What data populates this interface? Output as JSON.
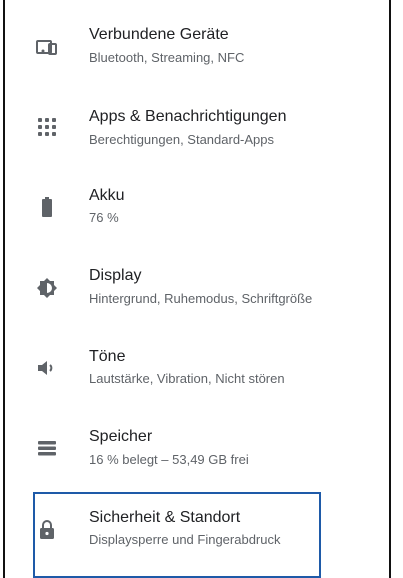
{
  "settings": {
    "items": [
      {
        "icon": "devices-icon",
        "title": "Verbundene Geräte",
        "subtitle": "Bluetooth, Streaming, NFC"
      },
      {
        "icon": "apps-grid-icon",
        "title": "Apps & Benachrichtigungen",
        "subtitle": "Berechtigungen, Standard-Apps"
      },
      {
        "icon": "battery-icon",
        "title": "Akku",
        "subtitle": "76 %"
      },
      {
        "icon": "brightness-icon",
        "title": "Display",
        "subtitle": "Hintergrund, Ruhemodus, Schriftgröße"
      },
      {
        "icon": "volume-icon",
        "title": "Töne",
        "subtitle": "Lautstärke, Vibration, Nicht stören"
      },
      {
        "icon": "storage-icon",
        "title": "Speicher",
        "subtitle": "16 % belegt – 53,49 GB frei"
      },
      {
        "icon": "lock-icon",
        "title": "Sicherheit & Standort",
        "subtitle": "Displaysperre und Fingerabdruck"
      }
    ]
  },
  "colors": {
    "title": "#202124",
    "subtitle": "#5f6368",
    "icon": "#5f6368",
    "focus": "#1e5aa8"
  }
}
